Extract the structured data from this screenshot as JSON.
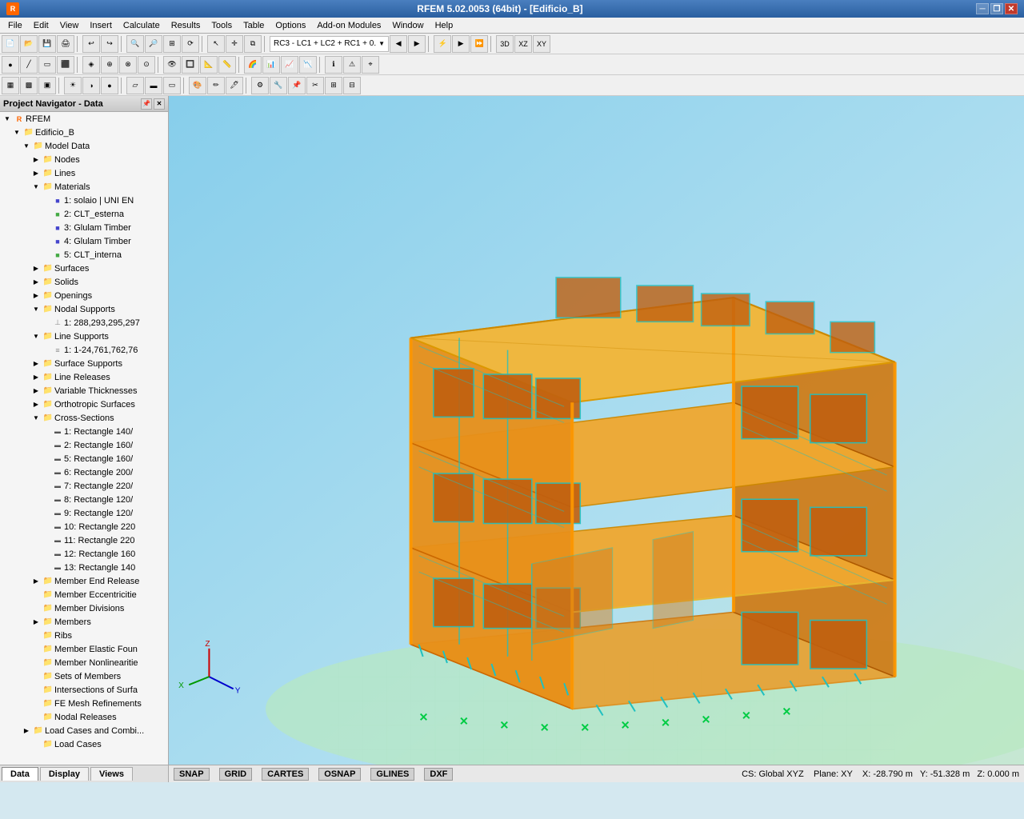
{
  "titleBar": {
    "appIcon": "R",
    "title": "RFEM 5.02.0053 (64bit) - [Edificio_B]",
    "minimize": "─",
    "restore": "❐",
    "close": "✕",
    "innerMin": "─",
    "innerRestore": "❐"
  },
  "menu": {
    "items": [
      "File",
      "Edit",
      "View",
      "Insert",
      "Calculate",
      "Results",
      "Tools",
      "Table",
      "Options",
      "Add-on Modules",
      "Window",
      "Help"
    ]
  },
  "toolbar1": {
    "comboLabel": "RC3 - LC1 + LC2 + RC1 + 0.",
    "prevBtn": "◀",
    "nextBtn": "▶"
  },
  "navigator": {
    "title": "Project Navigator - Data",
    "tree": [
      {
        "id": "rfem",
        "label": "RFEM",
        "level": 0,
        "type": "root",
        "icon": "root",
        "expanded": true
      },
      {
        "id": "edificio",
        "label": "Edificio_B",
        "level": 1,
        "type": "project",
        "icon": "folder",
        "expanded": true
      },
      {
        "id": "modeldata",
        "label": "Model Data",
        "level": 2,
        "type": "folder",
        "icon": "folder",
        "expanded": true
      },
      {
        "id": "nodes",
        "label": "Nodes",
        "level": 3,
        "type": "folder",
        "icon": "folder",
        "expanded": false
      },
      {
        "id": "lines",
        "label": "Lines",
        "level": 3,
        "type": "folder",
        "icon": "folder",
        "expanded": false
      },
      {
        "id": "materials",
        "label": "Materials",
        "level": 3,
        "type": "folder",
        "icon": "folder",
        "expanded": true
      },
      {
        "id": "mat1",
        "label": "1: solaio | UNI EN",
        "level": 4,
        "type": "material",
        "icon": "mat",
        "expanded": false
      },
      {
        "id": "mat2",
        "label": "2: CLT_esterna",
        "level": 4,
        "type": "material",
        "icon": "mat",
        "expanded": false
      },
      {
        "id": "mat3",
        "label": "3: Glulam Timber",
        "level": 4,
        "type": "material",
        "icon": "mat",
        "expanded": false
      },
      {
        "id": "mat4",
        "label": "4: Glulam Timber",
        "level": 4,
        "type": "material",
        "icon": "mat",
        "expanded": false
      },
      {
        "id": "mat5",
        "label": "5: CLT_interna",
        "level": 4,
        "type": "material",
        "icon": "mat",
        "expanded": false
      },
      {
        "id": "surfaces",
        "label": "Surfaces",
        "level": 3,
        "type": "folder",
        "icon": "folder",
        "expanded": false
      },
      {
        "id": "solids",
        "label": "Solids",
        "level": 3,
        "type": "folder",
        "icon": "folder",
        "expanded": false
      },
      {
        "id": "openings",
        "label": "Openings",
        "level": 3,
        "type": "folder",
        "icon": "folder",
        "expanded": false
      },
      {
        "id": "nodsup",
        "label": "Nodal Supports",
        "level": 3,
        "type": "folder",
        "icon": "folder",
        "expanded": true
      },
      {
        "id": "nodsup1",
        "label": "1: 288,293,295,297",
        "level": 4,
        "type": "item",
        "icon": "support",
        "expanded": false
      },
      {
        "id": "linesup",
        "label": "Line Supports",
        "level": 3,
        "type": "folder",
        "icon": "folder",
        "expanded": true
      },
      {
        "id": "linesup1",
        "label": "1: 1-24,761,762,76",
        "level": 4,
        "type": "item",
        "icon": "lsupport",
        "expanded": false
      },
      {
        "id": "surfsup",
        "label": "Surface Supports",
        "level": 3,
        "type": "folder",
        "icon": "folder",
        "expanded": false
      },
      {
        "id": "linerel",
        "label": "Line Releases",
        "level": 3,
        "type": "folder",
        "icon": "folder",
        "expanded": false
      },
      {
        "id": "varthick",
        "label": "Variable Thicknesses",
        "level": 3,
        "type": "folder",
        "icon": "folder",
        "expanded": false
      },
      {
        "id": "orthosur",
        "label": "Orthotropic Surfaces",
        "level": 3,
        "type": "folder",
        "icon": "folder",
        "expanded": false
      },
      {
        "id": "crosssec",
        "label": "Cross-Sections",
        "level": 3,
        "type": "folder",
        "icon": "folder",
        "expanded": true
      },
      {
        "id": "cs1",
        "label": "1: Rectangle 140/",
        "level": 4,
        "type": "crosssec",
        "icon": "cs",
        "expanded": false
      },
      {
        "id": "cs2",
        "label": "2: Rectangle 160/",
        "level": 4,
        "type": "crosssec",
        "icon": "cs",
        "expanded": false
      },
      {
        "id": "cs5",
        "label": "5: Rectangle 160/",
        "level": 4,
        "type": "crosssec",
        "icon": "cs",
        "expanded": false
      },
      {
        "id": "cs6",
        "label": "6: Rectangle 200/",
        "level": 4,
        "type": "crosssec",
        "icon": "cs",
        "expanded": false
      },
      {
        "id": "cs7",
        "label": "7: Rectangle 220/",
        "level": 4,
        "type": "crosssec",
        "icon": "cs",
        "expanded": false
      },
      {
        "id": "cs8",
        "label": "8: Rectangle 120/",
        "level": 4,
        "type": "crosssec",
        "icon": "cs",
        "expanded": false
      },
      {
        "id": "cs9",
        "label": "9: Rectangle 120/",
        "level": 4,
        "type": "crosssec",
        "icon": "cs",
        "expanded": false
      },
      {
        "id": "cs10",
        "label": "10: Rectangle 220",
        "level": 4,
        "type": "crosssec",
        "icon": "cs",
        "expanded": false
      },
      {
        "id": "cs11",
        "label": "11: Rectangle 220",
        "level": 4,
        "type": "crosssec",
        "icon": "cs",
        "expanded": false
      },
      {
        "id": "cs12",
        "label": "12: Rectangle 160",
        "level": 4,
        "type": "crosssec",
        "icon": "cs",
        "expanded": false
      },
      {
        "id": "cs13",
        "label": "13: Rectangle 140",
        "level": 4,
        "type": "crosssec",
        "icon": "cs",
        "expanded": false
      },
      {
        "id": "membend",
        "label": "Member End Release",
        "level": 3,
        "type": "folder",
        "icon": "folder",
        "expanded": false
      },
      {
        "id": "membecc",
        "label": "Member Eccentricitie",
        "level": 3,
        "type": "folder",
        "icon": "folder",
        "expanded": false
      },
      {
        "id": "membdiv",
        "label": "Member Divisions",
        "level": 3,
        "type": "folder",
        "icon": "folder",
        "expanded": false
      },
      {
        "id": "members",
        "label": "Members",
        "level": 3,
        "type": "folder",
        "icon": "folder",
        "expanded": false
      },
      {
        "id": "ribs",
        "label": "Ribs",
        "level": 3,
        "type": "folder",
        "icon": "folder",
        "expanded": false
      },
      {
        "id": "membelas",
        "label": "Member Elastic Foun",
        "level": 3,
        "type": "folder",
        "icon": "folder",
        "expanded": false
      },
      {
        "id": "membnon",
        "label": "Member Nonlinearitie",
        "level": 3,
        "type": "folder",
        "icon": "folder",
        "expanded": false
      },
      {
        "id": "setmemb",
        "label": "Sets of Members",
        "level": 3,
        "type": "folder",
        "icon": "folder",
        "expanded": false
      },
      {
        "id": "intersec",
        "label": "Intersections of Surfa",
        "level": 3,
        "type": "folder",
        "icon": "folder",
        "expanded": false
      },
      {
        "id": "femesh",
        "label": "FE Mesh Refinements",
        "level": 3,
        "type": "folder",
        "icon": "folder",
        "expanded": false
      },
      {
        "id": "nodalrel",
        "label": "Nodal Releases",
        "level": 3,
        "type": "folder",
        "icon": "folder",
        "expanded": false
      },
      {
        "id": "loadcases",
        "label": "Load Cases and Combi...",
        "level": 2,
        "type": "folder",
        "icon": "folder",
        "expanded": false
      },
      {
        "id": "loadcases2",
        "label": "Load Cases",
        "level": 3,
        "type": "folder",
        "icon": "folder",
        "expanded": false
      }
    ]
  },
  "navTabs": {
    "tabs": [
      "Data",
      "Display",
      "Views"
    ],
    "activeTab": "Data"
  },
  "statusBar": {
    "snap": "SNAP",
    "grid": "GRID",
    "cartes": "CARTES",
    "osnap": "OSNAP",
    "glines": "GLINES",
    "dxf": "DXF",
    "cs": "CS: Global XYZ",
    "plane": "Plane: XY",
    "xCoord": "X: -28.790 m",
    "yCoord": "Y: -51.328 m",
    "zCoord": "Z: 0.000 m"
  }
}
